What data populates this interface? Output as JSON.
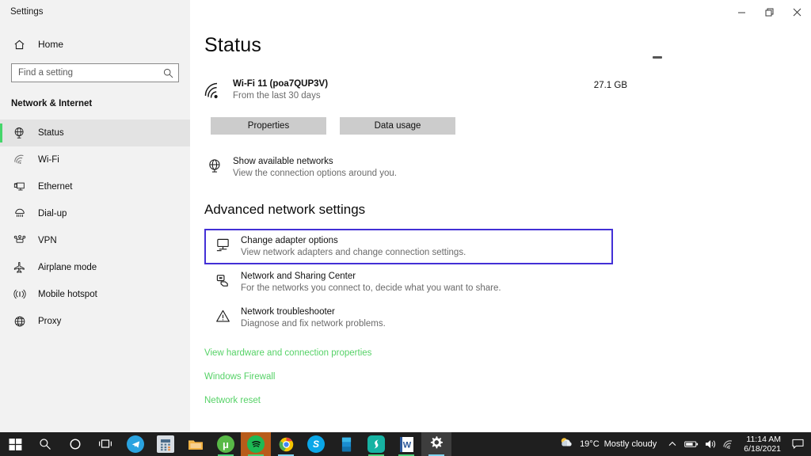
{
  "window": {
    "title": "Settings",
    "controls": {
      "minimize": "minimize-button",
      "restore": "restore-button",
      "close": "close-button"
    }
  },
  "sidebar": {
    "home_label": "Home",
    "search": {
      "placeholder": "Find a setting",
      "value": ""
    },
    "group_title": "Network & Internet",
    "items": [
      {
        "label": "Status",
        "icon": "globe-icon",
        "selected": true
      },
      {
        "label": "Wi-Fi",
        "icon": "wifi-icon",
        "selected": false
      },
      {
        "label": "Ethernet",
        "icon": "ethernet-icon",
        "selected": false
      },
      {
        "label": "Dial-up",
        "icon": "dialup-icon",
        "selected": false
      },
      {
        "label": "VPN",
        "icon": "vpn-icon",
        "selected": false
      },
      {
        "label": "Airplane mode",
        "icon": "airplane-icon",
        "selected": false
      },
      {
        "label": "Mobile hotspot",
        "icon": "hotspot-icon",
        "selected": false
      },
      {
        "label": "Proxy",
        "icon": "proxy-globe-icon",
        "selected": false
      }
    ]
  },
  "main": {
    "page_title": "Status",
    "status_card": {
      "icon": "wifi-signal-icon",
      "network_name": "Wi-Fi 11 (poa7QUP3V)",
      "period": "From the last 30 days",
      "data_used": "27.1 GB"
    },
    "buttons": {
      "properties": "Properties",
      "data_usage": "Data usage"
    },
    "show_networks": {
      "icon": "globe-icon",
      "title": "Show available networks",
      "subtitle": "View the connection options around you."
    },
    "section_heading": "Advanced network settings",
    "advanced_items": [
      {
        "icon": "monitor-icon",
        "title": "Change adapter options",
        "subtitle": "View network adapters and change connection settings.",
        "focused": true
      },
      {
        "icon": "sharing-icon",
        "title": "Network and Sharing Center",
        "subtitle": "For the networks you connect to, decide what you want to share.",
        "focused": false
      },
      {
        "icon": "warning-triangle-icon",
        "title": "Network troubleshooter",
        "subtitle": "Diagnose and fix network problems.",
        "focused": false
      }
    ],
    "links": [
      "View hardware and connection properties",
      "Windows Firewall",
      "Network reset"
    ]
  },
  "taskbar": {
    "items": [
      {
        "name": "start-button",
        "icon": "windows-logo-icon"
      },
      {
        "name": "search-button",
        "icon": "search-icon"
      },
      {
        "name": "cortana-button",
        "icon": "cortana-circle-icon"
      },
      {
        "name": "task-view-button",
        "icon": "task-view-icon"
      },
      {
        "name": "telegram-app",
        "icon": "telegram-icon"
      },
      {
        "name": "calculator-app",
        "icon": "calculator-icon"
      },
      {
        "name": "file-explorer-app",
        "icon": "folder-icon"
      },
      {
        "name": "utorrent-app",
        "icon": "utorrent-icon"
      },
      {
        "name": "spotify-app",
        "icon": "spotify-icon"
      },
      {
        "name": "chrome-app",
        "icon": "chrome-icon"
      },
      {
        "name": "skype-app",
        "icon": "skype-icon"
      },
      {
        "name": "phone-link-app",
        "icon": "phone-icon"
      },
      {
        "name": "surfshark-app",
        "icon": "surfshark-icon"
      },
      {
        "name": "word-app",
        "icon": "word-icon"
      },
      {
        "name": "settings-app",
        "icon": "gear-icon"
      }
    ],
    "tray": {
      "weather_temp": "19°C",
      "weather_condition": "Mostly cloudy",
      "chevron": "chevron-up-icon",
      "battery": "battery-icon",
      "volume": "volume-icon",
      "network": "wifi-icon",
      "time": "11:14 AM",
      "date": "6/18/2021",
      "action_center": "action-center-icon"
    }
  },
  "colors": {
    "accent_green": "#56d267",
    "focus_blue": "#4330d6",
    "selection_green": "#45d66b",
    "sidebar_bg": "#f2f2f2",
    "taskbar_bg": "#1f1f1f"
  }
}
